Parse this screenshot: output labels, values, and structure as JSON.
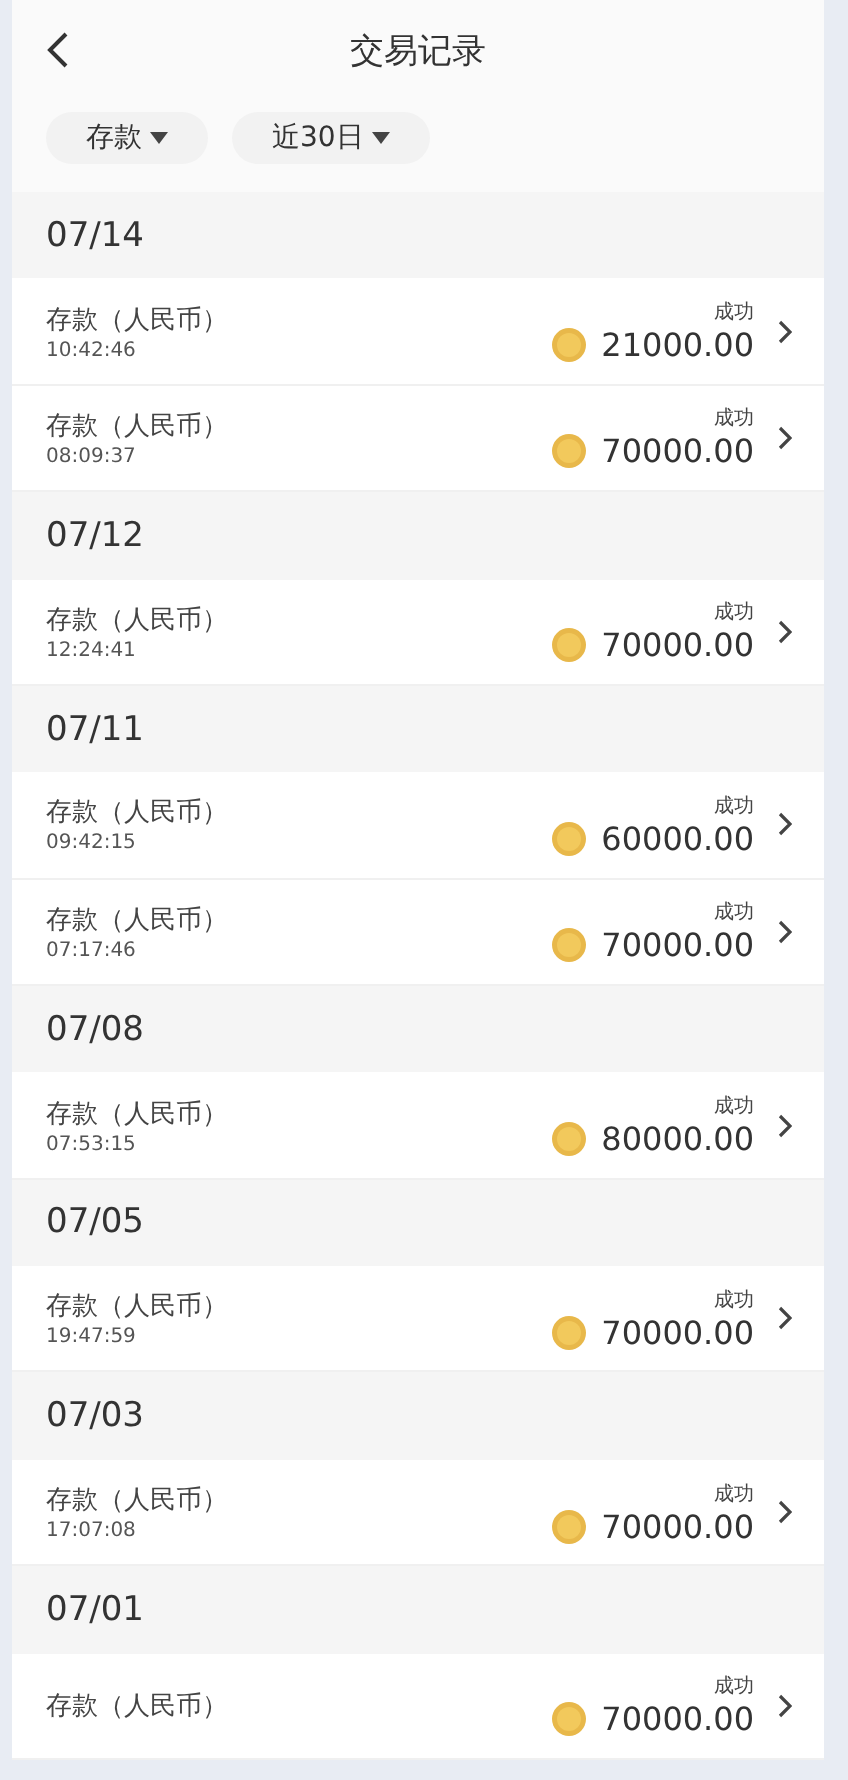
{
  "header": {
    "title": "交易记录"
  },
  "filters": [
    {
      "label": "存款"
    },
    {
      "label": "近30日"
    }
  ],
  "groups": [
    {
      "date": "07/14",
      "items": [
        {
          "title": "存款（人民币）",
          "time": "10:42:46",
          "status": "成功",
          "amount": "21000.00"
        },
        {
          "title": "存款（人民币）",
          "time": "08:09:37",
          "status": "成功",
          "amount": "70000.00"
        }
      ]
    },
    {
      "date": "07/12",
      "items": [
        {
          "title": "存款（人民币）",
          "time": "12:24:41",
          "status": "成功",
          "amount": "70000.00"
        }
      ]
    },
    {
      "date": "07/11",
      "items": [
        {
          "title": "存款（人民币）",
          "time": "09:42:15",
          "status": "成功",
          "amount": "60000.00"
        },
        {
          "title": "存款（人民币）",
          "time": "07:17:46",
          "status": "成功",
          "amount": "70000.00"
        }
      ]
    },
    {
      "date": "07/08",
      "items": [
        {
          "title": "存款（人民币）",
          "time": "07:53:15",
          "status": "成功",
          "amount": "80000.00"
        }
      ]
    },
    {
      "date": "07/05",
      "items": [
        {
          "title": "存款（人民币）",
          "time": "19:47:59",
          "status": "成功",
          "amount": "70000.00"
        }
      ]
    },
    {
      "date": "07/03",
      "items": [
        {
          "title": "存款（人民币）",
          "time": "17:07:08",
          "status": "成功",
          "amount": "70000.00"
        }
      ]
    },
    {
      "date": "07/01",
      "items": [
        {
          "title": "存款（人民币）",
          "status": "成功",
          "amount": "70000.00"
        }
      ]
    }
  ]
}
